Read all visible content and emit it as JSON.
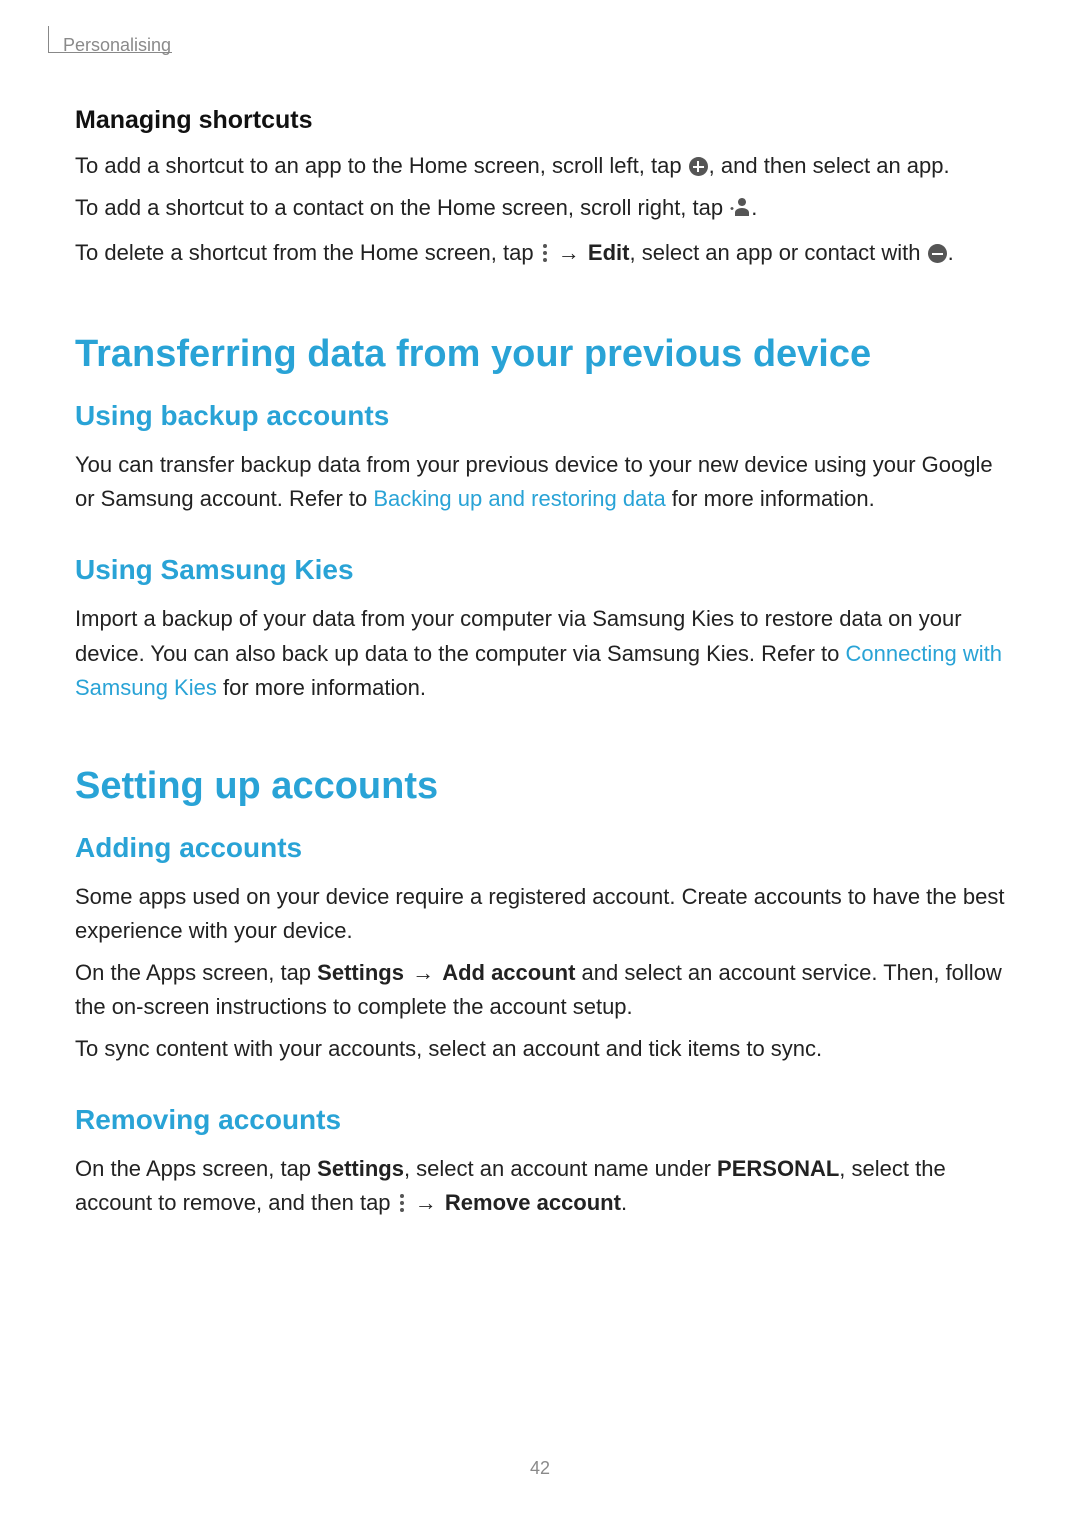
{
  "header": {
    "section_label": "Personalising"
  },
  "sections": {
    "managing_shortcuts": {
      "title": "Managing shortcuts",
      "p1_a": "To add a shortcut to an app to the Home screen, scroll left, tap ",
      "p1_b": ", and then select an app.",
      "p2_a": "To add a shortcut to a contact on the Home screen, scroll right, tap ",
      "p2_b": ".",
      "p3_a": "To delete a shortcut from the Home screen, tap ",
      "p3_arrow": " → ",
      "p3_edit": "Edit",
      "p3_b": ", select an app or contact with ",
      "p3_c": "."
    },
    "transferring": {
      "title": "Transferring data from your previous device",
      "backup_title": "Using backup accounts",
      "backup_p_a": "You can transfer backup data from your previous device to your new device using your Google or Samsung account. Refer to ",
      "backup_link": "Backing up and restoring data",
      "backup_p_b": " for more information.",
      "kies_title": "Using Samsung Kies",
      "kies_p_a": "Import a backup of your data from your computer via Samsung Kies to restore data on your device. You can also back up data to the computer via Samsung Kies. Refer to ",
      "kies_link": "Connecting with Samsung Kies",
      "kies_p_b": " for more information."
    },
    "setting_up": {
      "title": "Setting up accounts",
      "adding_title": "Adding accounts",
      "adding_p1": "Some apps used on your device require a registered account. Create accounts to have the best experience with your device.",
      "adding_p2_a": "On the Apps screen, tap ",
      "adding_p2_settings": "Settings",
      "adding_p2_arrow": " → ",
      "adding_p2_add": "Add account",
      "adding_p2_b": " and select an account service. Then, follow the on-screen instructions to complete the account setup.",
      "adding_p3": "To sync content with your accounts, select an account and tick items to sync.",
      "removing_title": "Removing accounts",
      "removing_p_a": "On the Apps screen, tap ",
      "removing_settings": "Settings",
      "removing_p_b": ", select an account name under ",
      "removing_personal": "PERSONAL",
      "removing_p_c": ", select the account to remove, and then tap ",
      "removing_arrow": " → ",
      "removing_remove": "Remove account",
      "removing_p_d": "."
    }
  },
  "page_number": "42"
}
